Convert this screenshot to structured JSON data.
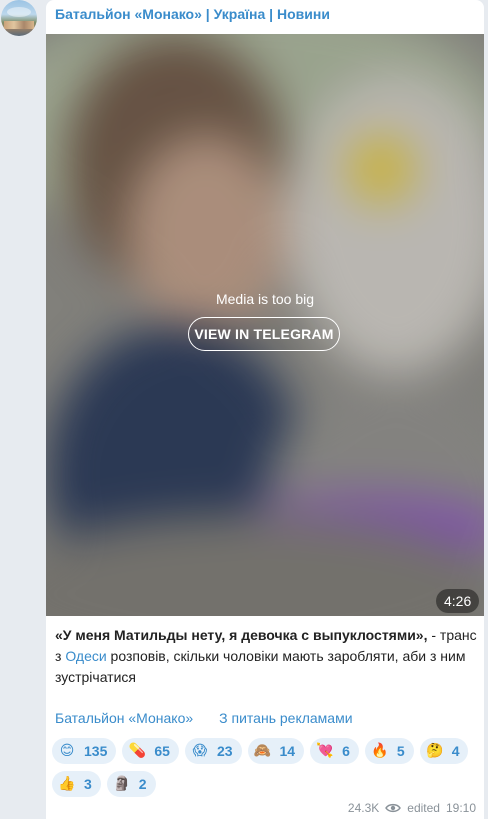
{
  "channel": {
    "title": "Батальйон «Монако» | Україна | Новини"
  },
  "media": {
    "notice": "Media is too big",
    "view_button_label": "VIEW IN TELEGRAM",
    "duration": "4:26"
  },
  "post": {
    "quote": "«У меня Матильды нету, я девочка с выпуклостями»,",
    "text_part1": " - транс з ",
    "city_link": "Одеси",
    "text_part2": " розповів, скільки чоловіки мають заробляти, аби з ним зустрічатися"
  },
  "links": {
    "channel_link": "Батальйон «Монако»",
    "ads_link": "З питань рекламами"
  },
  "reactions": [
    {
      "icon": "smiling-face-icon",
      "glyph": "😊",
      "count": "135"
    },
    {
      "icon": "pill-icon",
      "glyph": "💊",
      "count": "65"
    },
    {
      "icon": "screaming-face-icon",
      "glyph": "😱",
      "count": "23"
    },
    {
      "icon": "see-no-evil-monkey-icon",
      "glyph": "🙈",
      "count": "14"
    },
    {
      "icon": "heart-with-arrow-icon",
      "glyph": "💘",
      "count": "6"
    },
    {
      "icon": "fire-icon",
      "glyph": "🔥",
      "count": "5"
    },
    {
      "icon": "thinking-face-icon",
      "glyph": "🤔",
      "count": "4"
    },
    {
      "icon": "thumbs-up-icon",
      "glyph": "👍",
      "count": "3"
    },
    {
      "icon": "moai-icon",
      "glyph": "🗿",
      "count": "2"
    }
  ],
  "meta": {
    "views": "24.3K",
    "edited_label": "edited",
    "time": "19:10"
  },
  "colors": {
    "accent": "#3a8ccb",
    "background": "#e7ebf0",
    "reaction_bg": "#e6f0f9"
  }
}
